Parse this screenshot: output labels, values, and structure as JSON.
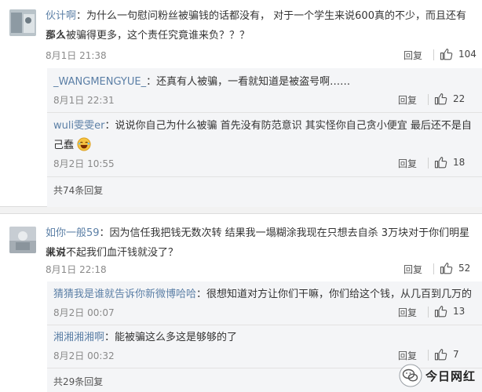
{
  "comments": [
    {
      "user": "伙计啊",
      "line1": "：为什么一句慰问粉丝被骗钱的话都没有， 对于一个学生来说600真的不少，而且还有那么",
      "line2": "多人被骗得更多，这个责任究竟谁来负？？？",
      "time": "8月1日 21:38",
      "reply_label": "回复",
      "likes": "104",
      "replies": [
        {
          "user": "_WANGMENGYUE_",
          "text": "：还真有人被骗，一看就知道是被盗号啊……",
          "time": "8月1日 22:31",
          "reply_label": "回复",
          "likes": "22"
        },
        {
          "user": "wuli雯雯er",
          "line1": "：说说你自己为什么被骗 首先没有防范意识 其实怪你自己贪小便宜 最后还不是自",
          "line2": "己蠢",
          "time": "8月2日 10:55",
          "reply_label": "回复",
          "likes": "18"
        }
      ],
      "more_replies": "共74条回复"
    },
    {
      "user": "如你一般59",
      "line1": "：因为信任我把钱无数次转 结果我一塌糊涂我现在只想去自杀 3万块对于你们明星来说",
      "line2": "就对不起我们血汗钱就没了？",
      "time": "8月1日 22:18",
      "reply_label": "回复",
      "likes": "52",
      "replies": [
        {
          "user": "猜猜我是谁就告诉你新微博哈哈",
          "text": "：很想知道对方让你们干嘛，你们给这个钱，从几百到几万的",
          "time": "8月2日 00:07",
          "reply_label": "回复",
          "likes": "13"
        },
        {
          "user": "湘湘湘湘啊",
          "text": "：能被骗这么多这是够够的了",
          "time": "8月2日 00:32",
          "reply_label": "回复",
          "likes": "7"
        }
      ],
      "more_replies": "共29条回复"
    }
  ],
  "watermark": "今日网红",
  "colors": {
    "username": "#5b7fa6",
    "reply_bg": "#f4f5f7",
    "time": "#8a8a8a"
  }
}
